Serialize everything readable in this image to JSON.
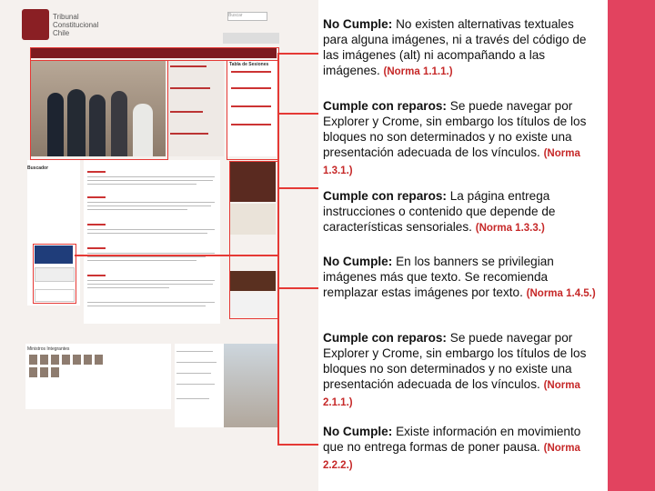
{
  "screenshot": {
    "brand_line1": "Tribunal",
    "brand_line2": "Constitucional",
    "brand_line3": "Chile",
    "search_placeholder": "Buscar",
    "nav": [
      "",
      "",
      "",
      "",
      "",
      "",
      ""
    ],
    "tabla_title": "Tabla de Sesiones",
    "buscador_label": "Buscador",
    "ministros_title": "Ministros Integrantes"
  },
  "notes": [
    {
      "status": "No Cumple:",
      "text": "No existen alternativas textuales para alguna imágenes, ni a través del código de las imágenes (alt) ni acompañando a las imágenes.",
      "norma": "(Norma 1.1.1.)"
    },
    {
      "status": "Cumple con reparos:",
      "text": "Se puede navegar por Explorer y Crome, sin embargo los títulos de los bloques no son determinados y no existe una presentación adecuada de los vínculos.",
      "norma": "(Norma 1.3.1.)"
    },
    {
      "status": "Cumple con reparos:",
      "text": "La página entrega instrucciones o contenido que depende de características sensoriales.",
      "norma": "(Norma 1.3.3.)"
    },
    {
      "status": "No Cumple:",
      "text": "En los banners se privilegian imágenes más que texto. Se recomienda remplazar estas imágenes por texto.",
      "norma": "(Norma 1.4.5.)"
    },
    {
      "status": "Cumple con reparos:",
      "text": "Se puede navegar por Explorer y Crome, sin embargo los títulos de los bloques no son determinados y no existe una presentación adecuada de los vínculos.",
      "norma": "(Norma 2.1.1.)"
    },
    {
      "status": "No Cumple:",
      "text": "Existe información en movimiento que no entrega formas de poner pausa.",
      "norma": "(Norma 2.2.2.)"
    }
  ],
  "colors": {
    "accent": "#e53935",
    "sidebar": "#e2435f",
    "brand": "#7d1a1f"
  }
}
